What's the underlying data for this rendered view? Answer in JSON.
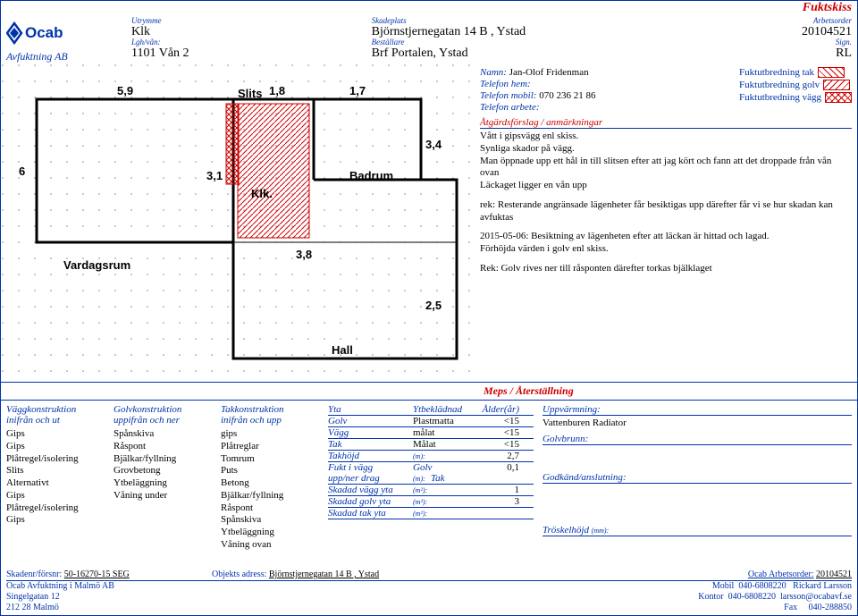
{
  "doc_title": "Fuktskiss",
  "header": {
    "company_sub": "Avfuktning AB",
    "utrymme_label": "Utrymme",
    "utrymme": "Klk",
    "lgh_label": "Lgh/vån:",
    "lgh": "1101 Vån 2",
    "skadeplats_label": "Skadeplats",
    "skadeplats": "Björnstjernegatan 14 B , Ystad",
    "bestallare_label": "Beställare",
    "bestallare": "Brf Portalen, Ystad",
    "arbetsorder_label": "Arbetsorder",
    "arbetsorder": "20104521",
    "sign_label": "Sign.",
    "sign": "RL"
  },
  "contact": {
    "namn_label": "Namn:",
    "namn": "Jan-Olof Fridenman",
    "tel_hem_label": "Telefon hem:",
    "tel_hem": "",
    "tel_mobil_label": "Telefon mobil:",
    "tel_mobil": "070 236 21 86",
    "tel_arbete_label": "Telefon arbete:",
    "tel_arbete": ""
  },
  "legend": {
    "tak": "Fuktutbredning tak",
    "golv": "Fuktutbredning golv",
    "vagg": "Fuktutbredning vägg"
  },
  "atg_head": "Åtgärdsförslag / anmärkningar",
  "notes": {
    "p1": "Vått i gipsvägg enl skiss.\nSynliga skador på vägg.\nMan öppnade upp ett hål in till slitsen efter att jag kört och fann att det droppade från vån ovan\nLäckaget ligger en vån upp",
    "p2": "rek: Resterande angränsade lägenheter får besiktigas upp därefter får vi se hur skadan kan avfuktas",
    "p3": "2015-05-06: Besiktning av lägenheten efter att läckan är hittad och lagad.\nFörhöjda värden i golv enl skiss.",
    "p4": "Rek: Golv rives ner till råsponten därefter torkas bjälklaget"
  },
  "plan_labels": {
    "d59": "5,9",
    "slits": "Slits",
    "d18": "1,8",
    "d17": "1,7",
    "d6": "6",
    "d31": "3,1",
    "klk": "Klk.",
    "badrum": "Badrum",
    "d34": "3,4",
    "vard": "Vardagsrum",
    "d38": "3,8",
    "d25": "2,5",
    "hall": "Hall"
  },
  "meps_head": "Meps / Återställning",
  "cols": {
    "vagg_head": "Väggkonstruktion\ninifrån och ut",
    "vagg_list": [
      "Gips",
      "Gips",
      "Plåtregel/isolering",
      "Slits",
      "Alternativt",
      "Gips",
      "Plåtregel/isolering",
      "Gips"
    ],
    "golv_head": "Golvkonstruktion\nuppifrån och ner",
    "golv_list": [
      "Spånskiva",
      "Råspont",
      "Bjälkar/fyllning",
      "Grovbetong",
      "Ytbeläggning",
      "Våning under"
    ],
    "tak_head": "Takkonstruktion\ninifrån och upp",
    "tak_list": [
      "gips",
      "Plåtreglar",
      "Tomrum",
      "Puts",
      "Betong",
      "Bjälkar/fyllning",
      "Råspont",
      "Spånskiva",
      "Ytbeläggning",
      "Våning ovan"
    ]
  },
  "yta": {
    "head_yta": "Yta",
    "head_bek": "Ytbeklädnad",
    "head_ald": "Ålder(år)",
    "rows": [
      {
        "a": "Golv",
        "b": "Plastmatta",
        "c": "<15"
      },
      {
        "a": "Vägg",
        "b": "målat",
        "c": "<15"
      },
      {
        "a": "Tak",
        "b": "Målat",
        "c": "<15"
      }
    ],
    "takhojd_l": "Takhöjd",
    "takhojd_u": "(m):",
    "takhojd_v": "2,7",
    "fukt_l": "Fukt i vägg",
    "fukt_golv": "Golv",
    "fukt_v": "0,1",
    "upp_l": "upp/ner drag",
    "upp_u": "(m):",
    "upp_tak": "Tak",
    "sv_l": "Skadad vägg yta",
    "sv_u": "(m²):",
    "sv_v": "1",
    "sg_l": "Skadad golv yta",
    "sg_u": "(m²):",
    "sg_v": "3",
    "st_l": "Skadad tak yta",
    "st_u": "(m²):",
    "st_v": ""
  },
  "right_lower": {
    "upp_l": "Uppvärmning:",
    "upp_v": "Vattenburen Radiator",
    "gb_l": "Golvbrunn:",
    "ga_l": "Godkänd/anslutning:",
    "tr_l": "Tröskelhöjd",
    "tr_u": "(mm):"
  },
  "footer": {
    "skadenr_l": "Skadenr/försnr:",
    "skadenr": "50-16270-15 SEG",
    "obj_l": "Objekts adress:",
    "obj": "Björnstjernegatan 14 B , Ystad",
    "arb_l": "Ocab Arbetsorder:",
    "arb": "20104521",
    "company": "Ocab Avfuktning i Malmö AB",
    "addr1": "Singelgatan 12",
    "addr2": "212 28 Malmö",
    "mobil_l": "Mobil",
    "mobil": "040-6808220",
    "person": "Rickard Larsson",
    "kontor_l": "Kontor",
    "kontor": "040-6808220",
    "email": "larsson@ocabavf.se",
    "fax_l": "Fax",
    "fax": "040-288850"
  }
}
